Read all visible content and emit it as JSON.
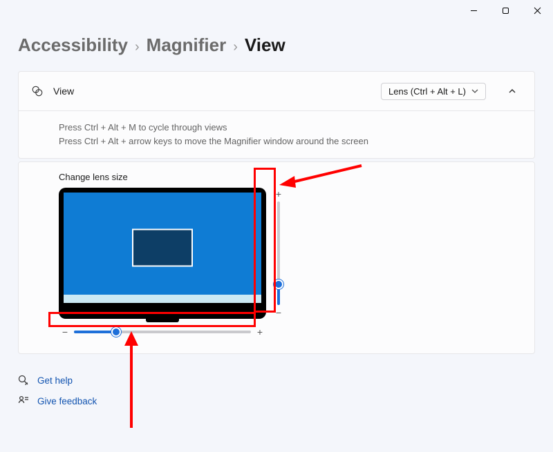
{
  "window": {
    "minimize": "Minimize",
    "restore": "Restore",
    "close": "Close"
  },
  "breadcrumb": {
    "level1": "Accessibility",
    "level2": "Magnifier",
    "current": "View",
    "sep": "›"
  },
  "viewCard": {
    "title": "View",
    "dropdown": {
      "selected": "Lens (Ctrl + Alt + L)"
    },
    "hint1": "Press Ctrl + Alt + M to cycle through views",
    "hint2": "Press Ctrl + Alt + arrow keys to move the Magnifier window around the screen"
  },
  "lens": {
    "title": "Change lens size",
    "vertical": {
      "minus": "−",
      "plus": "+",
      "value_pct": 20
    },
    "horizontal": {
      "minus": "−",
      "plus": "+",
      "value_pct": 24
    }
  },
  "links": {
    "help": "Get help",
    "feedback": "Give feedback"
  },
  "colors": {
    "accent": "#1e6fd9",
    "annotation": "#ff0000"
  }
}
